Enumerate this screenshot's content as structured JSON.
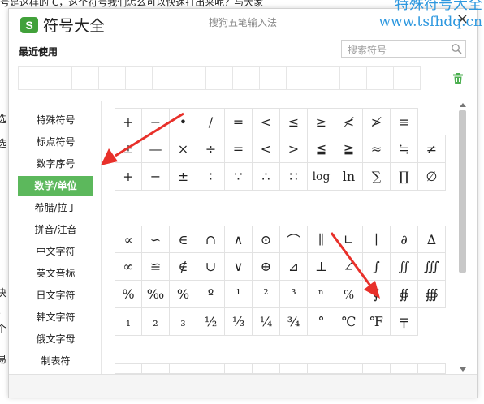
{
  "background": {
    "line1": "号是这样的 C，这个符号我们怎么可以快速打出来呢？与大家",
    "fragments": [
      "选",
      "选",
      "决",
      "。",
      "个",
      "易"
    ]
  },
  "watermark": {
    "line1": "特殊符号大全",
    "line2": "www.tsfhdq.cn",
    "color": "#2e98df"
  },
  "window": {
    "logo": "S",
    "title": "符号大全",
    "subtitle": "搜狗五笔输入法",
    "close": "×",
    "recent_label": "最近使用",
    "search_placeholder": "搜索符号",
    "accent_color": "#5cb85c"
  },
  "categories": [
    {
      "label": "特殊符号"
    },
    {
      "label": "标点符号"
    },
    {
      "label": "数字序号"
    },
    {
      "label": "数学/单位",
      "active": true
    },
    {
      "label": "希腊/拉丁"
    },
    {
      "label": "拼音/注音"
    },
    {
      "label": "中文字符"
    },
    {
      "label": "英文音标"
    },
    {
      "label": "日文字符"
    },
    {
      "label": "韩文字符"
    },
    {
      "label": "俄文字母"
    },
    {
      "label": "制表符"
    }
  ],
  "symbols": {
    "block1": [
      [
        "+",
        "−",
        "•",
        "/",
        "=",
        "<",
        "≤",
        "≥",
        "≮",
        "≯",
        "≡"
      ],
      [
        "±",
        "—",
        "×",
        "÷",
        "=",
        "<",
        ">",
        "≦",
        "≧",
        "≈",
        "≒",
        "≠"
      ],
      [
        "+",
        "−",
        "±",
        "∶",
        "∵",
        "∴",
        "∷",
        "log",
        "ln",
        "∑",
        "∏",
        "∅"
      ]
    ],
    "block2": [
      [
        "∝",
        "∽",
        "∈",
        "∩",
        "∧",
        "⊙",
        "⌒",
        "∥",
        "∟",
        "∣",
        "∂",
        "∆"
      ],
      [
        "∞",
        "≌",
        "∉",
        "∪",
        "∨",
        "⊕",
        "⊿",
        "⊥",
        "∠",
        "∫",
        "∬",
        "∭"
      ],
      [
        "%",
        "‰",
        "%",
        "º",
        "¹",
        "²",
        "³",
        "ⁿ",
        "℅",
        "∮",
        "∯",
        "∰"
      ],
      [
        "₁",
        "₂",
        "₃",
        "½",
        "⅓",
        "¼",
        "¾",
        "°",
        "℃",
        "℉",
        "〒"
      ]
    ]
  }
}
